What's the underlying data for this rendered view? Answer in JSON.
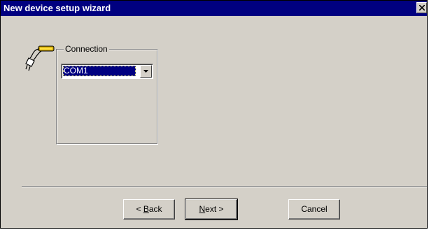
{
  "window": {
    "title": "New device setup wizard"
  },
  "icons": {
    "close": "close-icon",
    "connection": "serial-cable-icon",
    "dropdown": "chevron-down-icon"
  },
  "connection_group": {
    "label": "Connection",
    "selected_port": "COM1"
  },
  "buttons": {
    "back": {
      "mnemonic": "B",
      "rest": "ack",
      "prefix": "< "
    },
    "next": {
      "mnemonic": "N",
      "rest": "ext >",
      "prefix": ""
    },
    "cancel": {
      "label": "Cancel"
    }
  },
  "colors": {
    "dialog_face": "#d4d0c8",
    "titlebar": "#000080",
    "selection": "#000080"
  }
}
